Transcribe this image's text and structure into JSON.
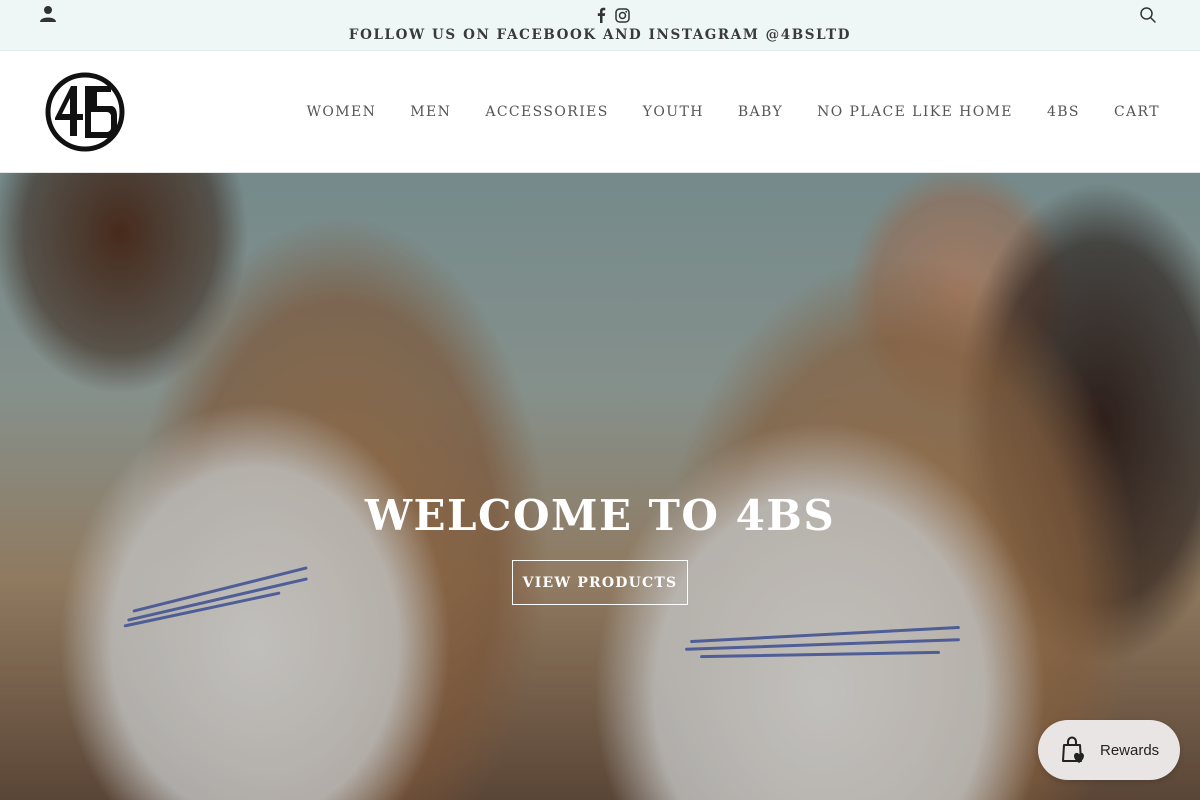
{
  "topbar": {
    "announcement": "FOLLOW US ON FACEBOOK AND INSTAGRAM @4BSLTD",
    "icons": {
      "account": "account-icon",
      "facebook": "facebook-icon",
      "instagram": "instagram-icon",
      "search": "search-icon"
    }
  },
  "header": {
    "logo_text": "4BS",
    "nav": [
      {
        "label": "WOMEN"
      },
      {
        "label": "MEN"
      },
      {
        "label": "ACCESSORIES"
      },
      {
        "label": "YOUTH"
      },
      {
        "label": "BABY"
      },
      {
        "label": "NO PLACE LIKE HOME"
      },
      {
        "label": "4BS"
      },
      {
        "label": "CART"
      }
    ]
  },
  "hero": {
    "title": "WELCOME TO 4BS",
    "button_label": "VIEW PRODUCTS"
  },
  "rewards": {
    "label": "Rewards",
    "icon": "shopping-bag-heart-icon"
  },
  "colors": {
    "topbar_bg": "#eef6f6",
    "text_dark": "#3a3a3a",
    "nav_text": "#555555",
    "hero_text": "#ffffff",
    "rewards_bg": "#e9e5e5"
  }
}
